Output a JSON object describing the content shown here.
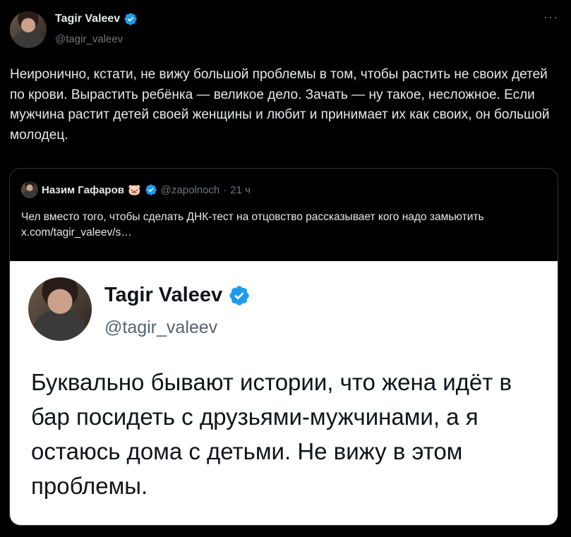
{
  "tweet": {
    "author": {
      "name": "Tagir Valeev",
      "handle": "@tagir_valeev",
      "verified": true
    },
    "more_icon": "more-horizontal-icon",
    "text": "Неиронично, кстати, не вижу большой проблемы в том, чтобы растить не своих детей по крови. Вырастить ребёнка — великое дело. Зачать — ну такое, несложное. Если мужчина растит детей своей женщины и любит и принимает их как своих, он большой молодец."
  },
  "quote": {
    "author": {
      "name": "Назим Гафаров",
      "emoji": "🐷",
      "handle": "@zapolnoch",
      "separator": "·",
      "time": "21 ч",
      "verified": true
    },
    "text": "Чел вместо того, чтобы сделать ДНК-тест на отцовство рассказывает кого надо замьютить",
    "link": "x.com/tagir_valeev/s…",
    "screenshot": {
      "name": "Tagir Valeev",
      "handle": "@tagir_valeev",
      "text": "Буквально бывают истории, что жена идёт в бар посидеть с друзьями-мужчинами, а я остаюсь дома с детьми. Не вижу в этом проблемы."
    }
  },
  "colors": {
    "background": "#000000",
    "text": "#e7e9ea",
    "secondary": "#71767b",
    "verified": "#1d9bf0",
    "border": "#2f3336"
  }
}
